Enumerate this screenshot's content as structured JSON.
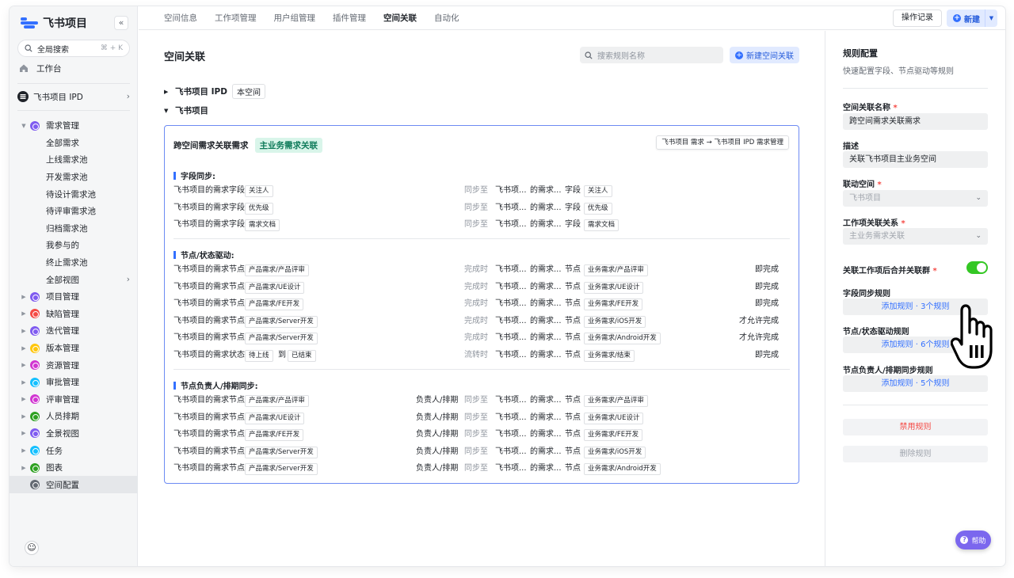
{
  "app": {
    "name": "飞书项目",
    "collapse_icon": "«"
  },
  "sidebar": {
    "search": {
      "label": "全局搜索",
      "shortcut": "⌘ + K"
    },
    "workbench": "工作台",
    "project": "飞书项目 IPD",
    "tree": [
      {
        "label": "需求管理",
        "color": "#7f5bf0",
        "arrow": "▼",
        "type": "module"
      },
      {
        "label": "全部需求",
        "type": "sub"
      },
      {
        "label": "上线需求池",
        "type": "sub"
      },
      {
        "label": "开发需求池",
        "type": "sub"
      },
      {
        "label": "待设计需求池",
        "type": "sub"
      },
      {
        "label": "待评审需求池",
        "type": "sub"
      },
      {
        "label": "归档需求池",
        "type": "sub"
      },
      {
        "label": "我参与的",
        "type": "sub"
      },
      {
        "label": "终止需求池",
        "type": "sub"
      },
      {
        "label": "全部视图",
        "type": "sub",
        "more": "›"
      },
      {
        "label": "项目管理",
        "color": "#7f5bf0",
        "arrow": "▶",
        "type": "module"
      },
      {
        "label": "缺陷管理",
        "color": "#f54a45",
        "arrow": "▶",
        "type": "module"
      },
      {
        "label": "迭代管理",
        "color": "#7f5bf0",
        "arrow": "▶",
        "type": "module"
      },
      {
        "label": "版本管理",
        "color": "#ffc60a",
        "arrow": "▶",
        "type": "module"
      },
      {
        "label": "资源管理",
        "color": "#d136d1",
        "arrow": "▶",
        "type": "module"
      },
      {
        "label": "审批管理",
        "color": "#14c0ff",
        "arrow": "▶",
        "type": "module"
      },
      {
        "label": "评审管理",
        "color": "#d136d1",
        "arrow": "▶",
        "type": "module"
      },
      {
        "label": "人员排期",
        "color": "#2ea121",
        "arrow": "▶",
        "type": "module"
      },
      {
        "label": "全景视图",
        "color": "#7f5bf0",
        "arrow": "▶",
        "type": "module"
      },
      {
        "label": "任务",
        "color": "#14c0ff",
        "arrow": "▶",
        "type": "module"
      },
      {
        "label": "图表",
        "color": "#2ea121",
        "arrow": "▶",
        "type": "module"
      },
      {
        "label": "空间配置",
        "color": "#646a73",
        "arrow": "",
        "type": "module",
        "active": true
      }
    ]
  },
  "topnav": {
    "tabs": [
      "空间信息",
      "工作项管理",
      "用户组管理",
      "插件管理",
      "空间关联",
      "自动化"
    ],
    "active": "空间关联",
    "op_record": "操作记录",
    "new_label": "新建"
  },
  "main": {
    "title": "空间关联",
    "search_placeholder": "搜索规则名称",
    "new_relation": "新建空间关联",
    "groups": [
      {
        "name": "飞书项目 IPD",
        "tag": "本空间",
        "arrow": "▶"
      },
      {
        "name": "飞书项目",
        "arrow": "▼"
      }
    ],
    "card": {
      "title": "跨空间需求关联需求",
      "tag": "主业务需求关联",
      "route": "飞书项目  需求  →  飞书项目 IPD  需求管理",
      "sections": {
        "field_sync": "字段同步:",
        "node_drive": "节点/状态驱动:",
        "owner_sync": "节点负责人/排期同步:"
      },
      "field_rows": [
        {
          "left": "飞书项目的需求字段",
          "chip": "关注人",
          "action": "同步至",
          "mid1": "飞书项...",
          "mid2": "的需求...",
          "kind": "字段",
          "target": "关注人"
        },
        {
          "left": "飞书项目的需求字段",
          "chip": "优先级",
          "action": "同步至",
          "mid1": "飞书项...",
          "mid2": "的需求...",
          "kind": "字段",
          "target": "优先级"
        },
        {
          "left": "飞书项目的需求字段",
          "chip": "需求文档",
          "action": "同步至",
          "mid1": "飞书项...",
          "mid2": "的需求...",
          "kind": "字段",
          "target": "需求文档"
        }
      ],
      "node_rows": [
        {
          "left": "飞书项目的需求节点",
          "chip": "产品需求/产品评审",
          "action": "完成时",
          "mid1": "飞书项...",
          "mid2": "的需求...",
          "kind": "节点",
          "target": "业务需求/产品评审",
          "result": "即完成"
        },
        {
          "left": "飞书项目的需求节点",
          "chip": "产品需求/UE设计",
          "action": "完成时",
          "mid1": "飞书项...",
          "mid2": "的需求...",
          "kind": "节点",
          "target": "业务需求/UE设计",
          "result": "即完成"
        },
        {
          "left": "飞书项目的需求节点",
          "chip": "产品需求/FE开发",
          "action": "完成时",
          "mid1": "飞书项...",
          "mid2": "的需求...",
          "kind": "节点",
          "target": "业务需求/FE开发",
          "result": "即完成"
        },
        {
          "left": "飞书项目的需求节点",
          "chip": "产品需求/Server开发",
          "action": "完成时",
          "mid1": "飞书项...",
          "mid2": "的需求...",
          "kind": "节点",
          "target": "业务需求/iOS开发",
          "result": "才允许完成"
        },
        {
          "left": "飞书项目的需求节点",
          "chip": "产品需求/Server开发",
          "action": "完成时",
          "mid1": "飞书项...",
          "mid2": "的需求...",
          "kind": "节点",
          "target": "业务需求/Android开发",
          "result": "才允许完成"
        },
        {
          "left": "飞书项目的需求状态",
          "chip": "待上线",
          "to": "到",
          "chip2": "已结束",
          "action": "流转时",
          "mid1": "飞书项...",
          "mid2": "的需求...",
          "kind": "节点",
          "target": "业务需求/结束",
          "result": "即完成"
        }
      ],
      "owner_rows": [
        {
          "left": "飞书项目的需求节点",
          "chip": "产品需求/产品评审",
          "what": "负责人/排期",
          "action": "同步至",
          "mid1": "飞书项...",
          "mid2": "的需求...",
          "kind": "节点",
          "target": "业务需求/产品评审"
        },
        {
          "left": "飞书项目的需求节点",
          "chip": "产品需求/UE设计",
          "what": "负责人/排期",
          "action": "同步至",
          "mid1": "飞书项...",
          "mid2": "的需求...",
          "kind": "节点",
          "target": "业务需求/UE设计"
        },
        {
          "left": "飞书项目的需求节点",
          "chip": "产品需求/FE开发",
          "what": "负责人/排期",
          "action": "同步至",
          "mid1": "飞书项...",
          "mid2": "的需求...",
          "kind": "节点",
          "target": "业务需求/FE开发"
        },
        {
          "left": "飞书项目的需求节点",
          "chip": "产品需求/Server开发",
          "what": "负责人/排期",
          "action": "同步至",
          "mid1": "飞书项...",
          "mid2": "的需求...",
          "kind": "节点",
          "target": "业务需求/iOS开发"
        },
        {
          "left": "飞书项目的需求节点",
          "chip": "产品需求/Server开发",
          "what": "负责人/排期",
          "action": "同步至",
          "mid1": "飞书项...",
          "mid2": "的需求...",
          "kind": "节点",
          "target": "业务需求/Android开发"
        }
      ]
    }
  },
  "panel": {
    "title": "规则配置",
    "desc": "快速配置字段、节点驱动等规则",
    "name_label": "空间关联名称",
    "name_value": "跨空间需求关联需求",
    "desc_label": "描述",
    "desc_value": "关联飞书项目主业务空间",
    "space_label": "联动空间",
    "space_value": "飞书项目",
    "relation_label": "工作项关联关系",
    "relation_value": "主业务需求关联",
    "merge_label": "关联工作项后合并关联群",
    "merge_on": true,
    "field_rule_label": "字段同步规则",
    "field_rule_btn": "添加规则 · 3个规则",
    "node_rule_label": "节点/状态驱动规则",
    "node_rule_btn": "添加规则 · 6个规则",
    "owner_rule_label": "节点负责人/排期同步规则",
    "owner_rule_btn": "添加规则 · 5个规则",
    "disable_btn": "禁用规则",
    "delete_btn": "删除规则",
    "required_mark": "*"
  },
  "help": "帮助",
  "colors": {
    "accent": "#3370ff",
    "danger": "#f54a45",
    "toggle_on": "#34c724",
    "help": "#7b67ee"
  }
}
